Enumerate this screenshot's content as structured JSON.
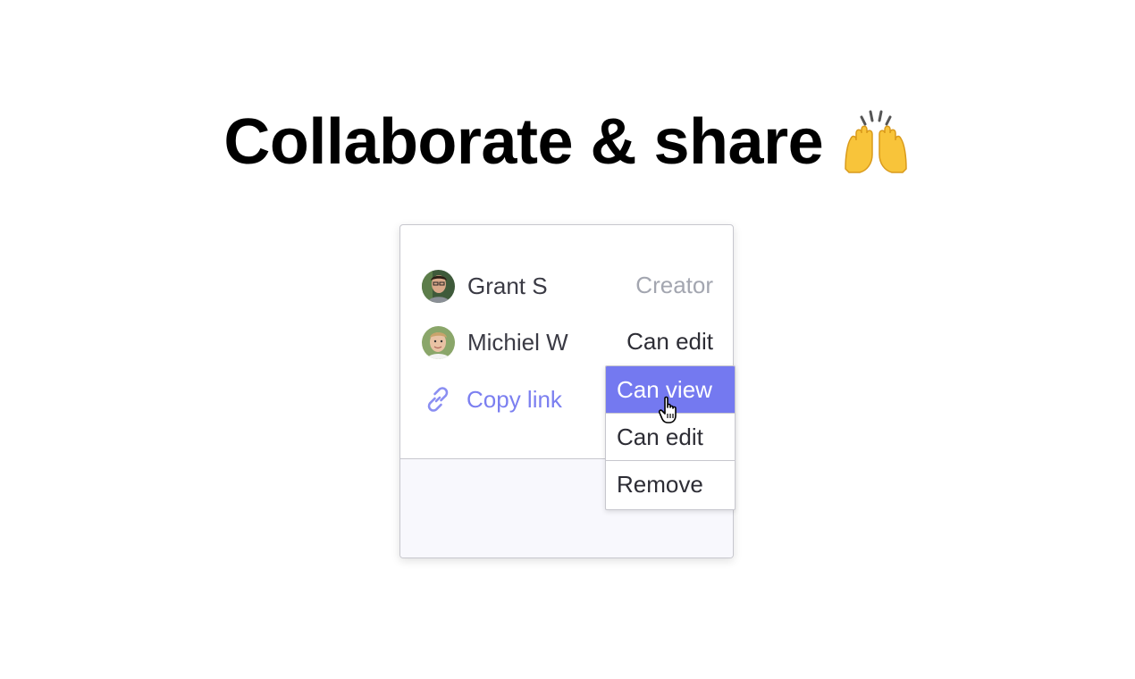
{
  "headline": {
    "text": "Collaborate & share",
    "emoji_icon": "raising-hands-icon"
  },
  "share_panel": {
    "members": [
      {
        "name": "Grant S",
        "role": "Creator",
        "avatar_icon": "avatar-photo"
      },
      {
        "name": "Michiel W",
        "role": "Can edit",
        "avatar_icon": "avatar-photo"
      }
    ],
    "copy_link": {
      "label": "Copy link",
      "icon": "link-icon",
      "color": "#7b7ff0"
    }
  },
  "role_dropdown": {
    "options": [
      {
        "label": "Can view",
        "selected": true
      },
      {
        "label": "Can edit",
        "selected": false
      },
      {
        "label": "Remove",
        "selected": false
      }
    ],
    "highlight_color": "#7479f0"
  },
  "pointer": {
    "icon": "hand-pointer-cursor-icon"
  }
}
